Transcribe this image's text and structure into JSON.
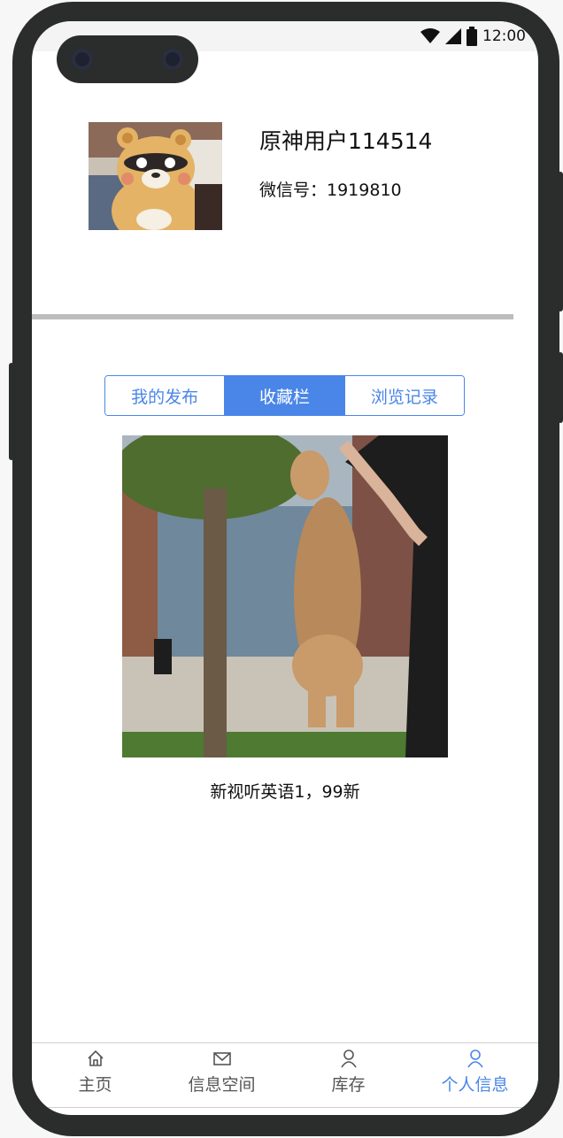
{
  "status_bar": {
    "time": "12:00",
    "icons": [
      "wifi-icon",
      "signal-icon",
      "battery-icon"
    ]
  },
  "profile": {
    "username": "原神用户114514",
    "wechat_id": "微信号：1919810",
    "avatar_icon": "bear-avatar-image"
  },
  "tabs": [
    {
      "label": "我的发布",
      "active": false
    },
    {
      "label": "收藏栏",
      "active": true
    },
    {
      "label": "浏览记录",
      "active": false
    }
  ],
  "post": {
    "caption": "新视听英语1，99新",
    "image_icon": "dog-photo"
  },
  "nav": [
    {
      "label": "主页",
      "icon": "home-icon",
      "active": false
    },
    {
      "label": "信息空间",
      "icon": "mail-icon",
      "active": false
    },
    {
      "label": "库存",
      "icon": "user-icon",
      "active": false
    },
    {
      "label": "个人信息",
      "icon": "user-icon",
      "active": true
    }
  ],
  "colors": {
    "accent": "#4a86e8",
    "phone_frame": "#2b2c2c",
    "divider": "#bdbdbd"
  }
}
